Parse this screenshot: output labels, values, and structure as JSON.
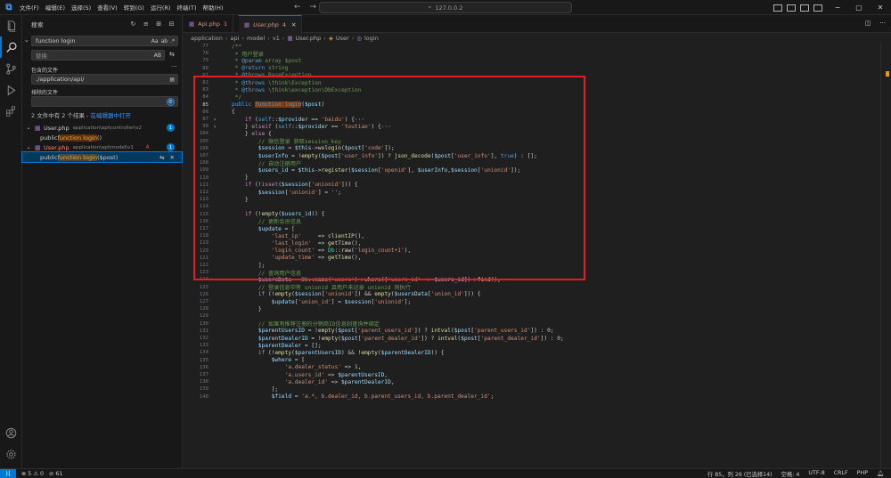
{
  "titlebar": {
    "menu": [
      "文件(F)",
      "编辑(E)",
      "选择(S)",
      "查看(V)",
      "转到(G)",
      "运行(R)",
      "终端(T)",
      "帮助(H)"
    ],
    "command_center": "127.0.0.2"
  },
  "sidebar": {
    "title": "搜索",
    "search_value": "function login",
    "replace_placeholder": "替换",
    "include_label": "包含的文件",
    "include_value": "./application/api/",
    "exclude_label": "排除的文件",
    "exclude_value": "",
    "summary_text": "2 文件中有 2 个结果 - ",
    "summary_link": "在编辑器中打开",
    "results": [
      {
        "file": "User.php",
        "path": "application\\api\\controller\\v2",
        "count": "1",
        "match_prefix": "public ",
        "match_hl": "function login",
        "match_suffix": "()",
        "errors": ""
      },
      {
        "file": "User.php",
        "path": "application\\api\\model\\v1",
        "count": "1",
        "errors": "4",
        "match_prefix": "public ",
        "match_hl": "function login",
        "match_suffix": "($post)"
      }
    ]
  },
  "tabs": [
    {
      "name": "Api.php",
      "count": "1",
      "active": false
    },
    {
      "name": "User.php",
      "count": "4",
      "active": true
    }
  ],
  "breadcrumb": [
    "application",
    "api",
    "model",
    "v1",
    "User.php",
    "User",
    "login"
  ],
  "code": [
    {
      "n": "77",
      "fold": "",
      "html": "<span class='t-c'>/**</span>"
    },
    {
      "n": "78",
      "fold": "",
      "html": "<span class='t-c'> * 用户登录</span>"
    },
    {
      "n": "79",
      "fold": "",
      "html": "<span class='t-c'> * </span><span class='t-k'>@param</span><span class='t-c'> array $post</span>"
    },
    {
      "n": "80",
      "fold": "",
      "html": "<span class='t-c'> * </span><span class='t-k'>@return</span><span class='t-c'> string</span>"
    },
    {
      "n": "81",
      "fold": "",
      "html": "<span class='t-c'> * </span><span class='t-k'>@throws</span><span class='t-c'> BaseException</span>"
    },
    {
      "n": "82",
      "fold": "",
      "html": "<span class='t-c'> * </span><span class='t-k'>@throws</span><span class='t-c'> \\think\\Exception</span>"
    },
    {
      "n": "83",
      "fold": "",
      "html": "<span class='t-c'> * </span><span class='t-k'>@throws</span><span class='t-c'> \\think\\exception\\DbException</span>"
    },
    {
      "n": "84",
      "fold": "",
      "html": "<span class='t-c'> */</span>"
    },
    {
      "n": "85",
      "fold": "",
      "html": "<span class='t-k'>public </span><span class='t-hl'>function login</span><span class='t-p'>(</span><span class='t-v'>$post</span><span class='t-p'>)</span>",
      "cur": true
    },
    {
      "n": "86",
      "fold": "",
      "html": "<span class='t-p'>{</span>"
    },
    {
      "n": "87",
      "fold": "›",
      "html": "    <span class='t-kw'>if</span><span class='t-p'> (</span><span class='t-k'>self</span><span class='t-p'>::</span><span class='t-v'>$provider</span><span class='t-p'> == </span><span class='t-s'>'baidu'</span><span class='t-p'>) {···</span>"
    },
    {
      "n": "99",
      "fold": "›",
      "html": "    <span class='t-p'>} </span><span class='t-kw'>elseif</span><span class='t-p'> (</span><span class='t-k'>self</span><span class='t-p'>::</span><span class='t-v'>$provider</span><span class='t-p'> == </span><span class='t-s'>'toutiao'</span><span class='t-p'>) {···</span>"
    },
    {
      "n": "104",
      "fold": "",
      "html": "    <span class='t-p'>} </span><span class='t-kw'>else</span><span class='t-p'> {</span>"
    },
    {
      "n": "105",
      "fold": "",
      "html": "        <span class='t-c'>// 微信登录 获取session_key</span>"
    },
    {
      "n": "106",
      "fold": "",
      "html": "        <span class='t-v'>$session</span><span class='t-p'> = </span><span class='t-v'>$this</span><span class='t-p'>-></span><span class='t-f'>wxlogin</span><span class='t-p'>(</span><span class='t-v'>$post</span><span class='t-p'>[</span><span class='t-s'>'code'</span><span class='t-p'>]);</span>"
    },
    {
      "n": "107",
      "fold": "",
      "html": "        <span class='t-v'>$userInfo</span><span class='t-p'> = !</span><span class='t-f'>empty</span><span class='t-p'>(</span><span class='t-v'>$post</span><span class='t-p'>[</span><span class='t-s'>'user_info'</span><span class='t-p'>]) ? </span><span class='t-f'>json_decode</span><span class='t-p'>(</span><span class='t-v'>$post</span><span class='t-p'>[</span><span class='t-s'>'user_info'</span><span class='t-p'>], </span><span class='t-k'>true</span><span class='t-p'>) : [];</span>"
    },
    {
      "n": "108",
      "fold": "",
      "html": "        <span class='t-c'>// 自动注册用户</span>"
    },
    {
      "n": "109",
      "fold": "",
      "html": "        <span class='t-v'>$users_id</span><span class='t-p'> = </span><span class='t-v'>$this</span><span class='t-p'>-></span><span class='t-f'>register</span><span class='t-p'>(</span><span class='t-v'>$session</span><span class='t-p'>[</span><span class='t-s'>'openid'</span><span class='t-p'>], </span><span class='t-v'>$userInfo</span><span class='t-p'>,</span><span class='t-v'>$session</span><span class='t-p'>[</span><span class='t-s'>'unionid'</span><span class='t-p'>]);</span>"
    },
    {
      "n": "110",
      "fold": "",
      "html": "    <span class='t-p'>}</span>"
    },
    {
      "n": "111",
      "fold": "",
      "html": "    <span class='t-kw'>if</span><span class='t-p'> (!</span><span class='t-kw'>isset</span><span class='t-p'>(</span><span class='t-v'>$session</span><span class='t-p'>[</span><span class='t-s'>'unionid'</span><span class='t-p'>])) {</span>"
    },
    {
      "n": "112",
      "fold": "",
      "html": "        <span class='t-v'>$session</span><span class='t-p'>[</span><span class='t-s'>'unionid'</span><span class='t-p'>] = </span><span class='t-s'>''</span><span class='t-p'>;</span>"
    },
    {
      "n": "113",
      "fold": "",
      "html": "    <span class='t-p'>}</span>"
    },
    {
      "n": "114",
      "fold": "",
      "html": ""
    },
    {
      "n": "115",
      "fold": "",
      "html": "    <span class='t-kw'>if</span><span class='t-p'> (!</span><span class='t-f'>empty</span><span class='t-p'>(</span><span class='t-v'>$users_id</span><span class='t-p'>)) {</span>"
    },
    {
      "n": "116",
      "fold": "",
      "html": "        <span class='t-c'>// 更新会员信息</span>"
    },
    {
      "n": "117",
      "fold": "",
      "html": "        <span class='t-v'>$update</span><span class='t-p'> = [</span>"
    },
    {
      "n": "118",
      "fold": "",
      "html": "            <span class='t-s'>'last_ip'</span><span class='t-p'>     => </span><span class='t-f'>clientIP</span><span class='t-p'>(),</span>"
    },
    {
      "n": "119",
      "fold": "",
      "html": "            <span class='t-s'>'last_login'</span><span class='t-p'>  => </span><span class='t-f'>getTime</span><span class='t-p'>(),</span>"
    },
    {
      "n": "120",
      "fold": "",
      "html": "            <span class='t-s'>'login_count'</span><span class='t-p'> => </span><span class='t-cls'>Db</span><span class='t-p'>::</span><span class='t-f'>raw</span><span class='t-p'>(</span><span class='t-s'>'login_count+1'</span><span class='t-p'>),</span>"
    },
    {
      "n": "121",
      "fold": "",
      "html": "            <span class='t-s'>'update_time'</span><span class='t-p'> => </span><span class='t-f'>getTime</span><span class='t-p'>(),</span>"
    },
    {
      "n": "122",
      "fold": "",
      "html": "        <span class='t-p'>];</span>"
    },
    {
      "n": "123",
      "fold": "",
      "html": "        <span class='t-c'>// 查询用户信息</span>"
    },
    {
      "n": "124",
      "fold": "",
      "html": "        <span class='t-v'>$usersData</span><span class='t-p'> = </span><span class='t-cls'>Db</span><span class='t-p'>::</span><span class='t-f'>name</span><span class='t-p'>(</span><span class='t-s'>'users'</span><span class='t-p'>)-></span><span class='t-f'>where</span><span class='t-p'>([</span><span class='t-s'>'users_id'</span><span class='t-p'> => </span><span class='t-v'>$users_id</span><span class='t-p'>])-></span><span class='t-f'>find</span><span class='t-p'>();</span>"
    },
    {
      "n": "125",
      "fold": "",
      "html": "        <span class='t-c'>// 登录信息中有 unionid 且用户未记录 unionid 则执行</span>"
    },
    {
      "n": "126",
      "fold": "",
      "html": "        <span class='t-kw'>if</span><span class='t-p'> (!</span><span class='t-f'>empty</span><span class='t-p'>(</span><span class='t-v'>$session</span><span class='t-p'>[</span><span class='t-s'>'unionid'</span><span class='t-p'>]) && </span><span class='t-f'>empty</span><span class='t-p'>(</span><span class='t-v'>$usersData</span><span class='t-p'>[</span><span class='t-s'>'union_id'</span><span class='t-p'>])) {</span>"
    },
    {
      "n": "127",
      "fold": "",
      "html": "            <span class='t-v'>$update</span><span class='t-p'>[</span><span class='t-s'>'union_id'</span><span class='t-p'>] = </span><span class='t-v'>$session</span><span class='t-p'>[</span><span class='t-s'>'unionid'</span><span class='t-p'>];</span>"
    },
    {
      "n": "128",
      "fold": "",
      "html": "        <span class='t-p'>}</span>"
    },
    {
      "n": "129",
      "fold": "",
      "html": ""
    },
    {
      "n": "130",
      "fold": "",
      "html": "        <span class='t-c'>// 如果有推荐注册的分销商ID信息则查询并绑定</span>"
    },
    {
      "n": "131",
      "fold": "",
      "html": "        <span class='t-v'>$parentUsersID</span><span class='t-p'> = !</span><span class='t-f'>empty</span><span class='t-p'>(</span><span class='t-v'>$post</span><span class='t-p'>[</span><span class='t-s'>'parent_users_id'</span><span class='t-p'>]) ? </span><span class='t-f'>intval</span><span class='t-p'>(</span><span class='t-v'>$post</span><span class='t-p'>[</span><span class='t-s'>'parent_users_id'</span><span class='t-p'>]) : </span><span class='t-n'>0</span><span class='t-p'>;</span>"
    },
    {
      "n": "132",
      "fold": "",
      "html": "        <span class='t-v'>$parentDealerID</span><span class='t-p'> = !</span><span class='t-f'>empty</span><span class='t-p'>(</span><span class='t-v'>$post</span><span class='t-p'>[</span><span class='t-s'>'parent_dealer_id'</span><span class='t-p'>]) ? </span><span class='t-f'>intval</span><span class='t-p'>(</span><span class='t-v'>$post</span><span class='t-p'>[</span><span class='t-s'>'parent_dealer_id'</span><span class='t-p'>]) : </span><span class='t-n'>0</span><span class='t-p'>;</span>"
    },
    {
      "n": "133",
      "fold": "",
      "html": "        <span class='t-v'>$parentDealer</span><span class='t-p'> = [];</span>"
    },
    {
      "n": "134",
      "fold": "",
      "html": "        <span class='t-kw'>if</span><span class='t-p'> (!</span><span class='t-f'>empty</span><span class='t-p'>(</span><span class='t-v'>$parentUsersID</span><span class='t-p'>) && !</span><span class='t-f'>empty</span><span class='t-p'>(</span><span class='t-v'>$parentDealerID</span><span class='t-p'>)) {</span>"
    },
    {
      "n": "135",
      "fold": "",
      "html": "            <span class='t-v'>$where</span><span class='t-p'> = [</span>"
    },
    {
      "n": "136",
      "fold": "",
      "html": "                <span class='t-s'>'a.dealer_status'</span><span class='t-p'> => </span><span class='t-n'>1</span><span class='t-p'>,</span>"
    },
    {
      "n": "137",
      "fold": "",
      "html": "                <span class='t-s'>'a.users_id'</span><span class='t-p'> => </span><span class='t-v'>$parentUsersID</span><span class='t-p'>,</span>"
    },
    {
      "n": "138",
      "fold": "",
      "html": "                <span class='t-s'>'a.dealer_id'</span><span class='t-p'> => </span><span class='t-v'>$parentDealerID</span><span class='t-p'>,</span>"
    },
    {
      "n": "139",
      "fold": "",
      "html": "            <span class='t-p'>];</span>"
    },
    {
      "n": "140",
      "fold": "",
      "html": "            <span class='t-v'>$field</span><span class='t-p'> = </span><span class='t-s'>'a.*, b.dealer_id, b.parent_users_id, b.parent_dealer_id'</span><span class='t-p'>;</span>"
    }
  ],
  "statusbar": {
    "remote": "⟩⟨",
    "errors": "5",
    "warnings": "0",
    "ports": "61",
    "position": "行 85，列 26 (已选择14)",
    "spaces": "空格: 4",
    "encoding": "UTF-8",
    "eol": "CRLF",
    "language": "PHP"
  }
}
